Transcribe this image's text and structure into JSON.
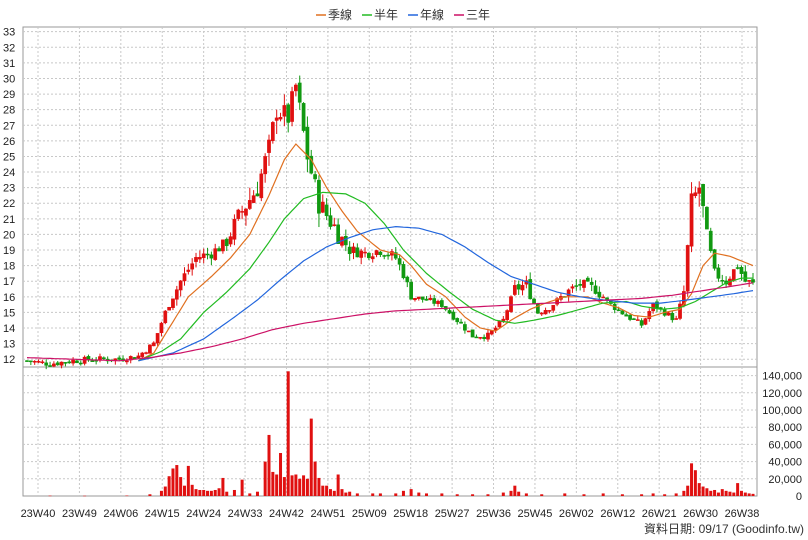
{
  "chart_data": {
    "type": "candlestick",
    "legend": [
      {
        "name": "季線",
        "color": "#e07020"
      },
      {
        "name": "半年",
        "color": "#22bb22"
      },
      {
        "name": "年線",
        "color": "#2266dd"
      },
      {
        "name": "三年",
        "color": "#cc1166"
      }
    ],
    "price_axis": {
      "min": 11.5,
      "max": 33.3,
      "ticks": [
        12,
        13,
        14,
        15,
        16,
        17,
        18,
        19,
        20,
        21,
        22,
        23,
        24,
        25,
        26,
        27,
        28,
        29,
        30,
        31,
        32,
        33
      ]
    },
    "volume_axis": {
      "min": 0,
      "max": 150000,
      "ticks": [
        0,
        20000,
        40000,
        60000,
        80000,
        100000,
        120000,
        140000
      ],
      "tick_labels": [
        "0",
        "20,000",
        "40,000",
        "60,000",
        "80,000",
        "100,000",
        "120,000",
        "140,000"
      ]
    },
    "x_labels": [
      "23W40",
      "23W49",
      "24W06",
      "24W15",
      "24W24",
      "24W33",
      "24W42",
      "24W51",
      "25W09",
      "25W18",
      "25W27",
      "25W36",
      "25W45",
      "26W02",
      "26W12",
      "26W21",
      "26W30",
      "26W38"
    ],
    "price_anchors": [
      [
        0,
        11.9
      ],
      [
        6,
        11.7
      ],
      [
        12,
        11.9
      ],
      [
        18,
        12.0
      ],
      [
        24,
        12.0
      ],
      [
        29,
        12.2
      ],
      [
        33,
        13.0
      ],
      [
        36,
        15.0
      ],
      [
        40,
        17.0
      ],
      [
        44,
        18.5
      ],
      [
        48,
        18.8
      ],
      [
        52,
        19.5
      ],
      [
        56,
        21.5
      ],
      [
        60,
        23.0
      ],
      [
        63,
        25.5
      ],
      [
        65,
        28.0
      ],
      [
        68,
        27.5
      ],
      [
        70,
        29.5
      ],
      [
        73,
        25.0
      ],
      [
        76,
        22.0
      ],
      [
        80,
        20.5
      ],
      [
        84,
        19.0
      ],
      [
        88,
        18.8
      ],
      [
        92,
        19.0
      ],
      [
        96,
        18.5
      ],
      [
        98,
        17.5
      ],
      [
        100,
        16.0
      ],
      [
        104,
        15.8
      ],
      [
        108,
        15.5
      ],
      [
        112,
        14.5
      ],
      [
        116,
        13.5
      ],
      [
        120,
        13.5
      ],
      [
        124,
        14.5
      ],
      [
        127,
        16.5
      ],
      [
        130,
        16.8
      ],
      [
        133,
        15.0
      ],
      [
        136,
        15.3
      ],
      [
        140,
        16.2
      ],
      [
        144,
        16.8
      ],
      [
        148,
        16.5
      ],
      [
        152,
        15.5
      ],
      [
        156,
        14.8
      ],
      [
        160,
        14.2
      ],
      [
        163,
        15.5
      ],
      [
        166,
        15.0
      ],
      [
        169,
        14.5
      ],
      [
        171,
        16.3
      ],
      [
        173,
        22.0
      ],
      [
        175,
        23.0
      ],
      [
        177,
        20.0
      ],
      [
        179,
        17.5
      ],
      [
        182,
        17.0
      ],
      [
        185,
        18.0
      ],
      [
        187,
        17.0
      ],
      [
        189,
        16.8
      ]
    ],
    "ma_anchors": {
      "season": [
        [
          29,
          11.9
        ],
        [
          33,
          12.4
        ],
        [
          37,
          14.0
        ],
        [
          42,
          16.0
        ],
        [
          48,
          17.3
        ],
        [
          53,
          18.5
        ],
        [
          58,
          20.0
        ],
        [
          63,
          22.5
        ],
        [
          67,
          24.8
        ],
        [
          70,
          25.8
        ],
        [
          74,
          24.8
        ],
        [
          78,
          23.0
        ],
        [
          82,
          21.5
        ],
        [
          86,
          20.2
        ],
        [
          92,
          19.0
        ],
        [
          97,
          18.7
        ],
        [
          100,
          18.0
        ],
        [
          104,
          16.8
        ],
        [
          109,
          16.0
        ],
        [
          114,
          14.7
        ],
        [
          118,
          14.0
        ],
        [
          122,
          13.8
        ],
        [
          126,
          14.5
        ],
        [
          131,
          15.2
        ],
        [
          135,
          15.6
        ],
        [
          140,
          16.0
        ],
        [
          146,
          16.0
        ],
        [
          150,
          15.6
        ],
        [
          154,
          15.3
        ],
        [
          158,
          14.8
        ],
        [
          162,
          14.7
        ],
        [
          166,
          15.0
        ],
        [
          170,
          15.2
        ],
        [
          173,
          16.2
        ],
        [
          176,
          18.0
        ],
        [
          179,
          18.8
        ],
        [
          183,
          18.6
        ],
        [
          186,
          18.3
        ],
        [
          189,
          18.0
        ]
      ],
      "half": [
        [
          29,
          11.9
        ],
        [
          35,
          12.5
        ],
        [
          40,
          13.3
        ],
        [
          46,
          15.0
        ],
        [
          52,
          16.3
        ],
        [
          58,
          17.8
        ],
        [
          63,
          19.5
        ],
        [
          67,
          21.0
        ],
        [
          72,
          22.3
        ],
        [
          77,
          22.7
        ],
        [
          83,
          22.6
        ],
        [
          88,
          22.0
        ],
        [
          93,
          20.7
        ],
        [
          98,
          19.0
        ],
        [
          104,
          17.5
        ],
        [
          110,
          16.3
        ],
        [
          116,
          15.2
        ],
        [
          122,
          14.5
        ],
        [
          127,
          14.3
        ],
        [
          132,
          14.5
        ],
        [
          138,
          14.8
        ],
        [
          144,
          15.2
        ],
        [
          150,
          15.6
        ],
        [
          156,
          15.7
        ],
        [
          160,
          15.4
        ],
        [
          165,
          15.2
        ],
        [
          170,
          15.3
        ],
        [
          174,
          15.7
        ],
        [
          178,
          16.3
        ],
        [
          182,
          16.9
        ],
        [
          186,
          17.2
        ],
        [
          189,
          17.2
        ]
      ],
      "year": [
        [
          29,
          11.9
        ],
        [
          38,
          12.4
        ],
        [
          46,
          13.3
        ],
        [
          54,
          14.7
        ],
        [
          60,
          15.8
        ],
        [
          66,
          17.1
        ],
        [
          72,
          18.3
        ],
        [
          78,
          19.2
        ],
        [
          84,
          19.8
        ],
        [
          90,
          20.3
        ],
        [
          96,
          20.5
        ],
        [
          102,
          20.4
        ],
        [
          108,
          20.0
        ],
        [
          114,
          19.2
        ],
        [
          120,
          18.2
        ],
        [
          126,
          17.3
        ],
        [
          132,
          16.8
        ],
        [
          138,
          16.3
        ],
        [
          144,
          16.0
        ],
        [
          150,
          15.8
        ],
        [
          158,
          15.6
        ],
        [
          165,
          15.6
        ],
        [
          172,
          15.8
        ],
        [
          178,
          16.0
        ],
        [
          184,
          16.2
        ],
        [
          189,
          16.4
        ]
      ],
      "three": [
        [
          0,
          12.1
        ],
        [
          12,
          12.0
        ],
        [
          24,
          11.9
        ],
        [
          32,
          12.1
        ],
        [
          40,
          12.4
        ],
        [
          48,
          12.8
        ],
        [
          56,
          13.3
        ],
        [
          64,
          13.9
        ],
        [
          72,
          14.3
        ],
        [
          80,
          14.6
        ],
        [
          88,
          14.9
        ],
        [
          96,
          15.1
        ],
        [
          104,
          15.2
        ],
        [
          112,
          15.3
        ],
        [
          120,
          15.4
        ],
        [
          128,
          15.5
        ],
        [
          136,
          15.6
        ],
        [
          144,
          15.7
        ],
        [
          152,
          15.8
        ],
        [
          160,
          15.9
        ],
        [
          168,
          16.1
        ],
        [
          176,
          16.4
        ],
        [
          184,
          16.7
        ],
        [
          189,
          16.9
        ]
      ]
    },
    "volume_spikes": [
      [
        6,
        400
      ],
      [
        15,
        300
      ],
      [
        26,
        500
      ],
      [
        32,
        2000
      ],
      [
        35,
        6000
      ],
      [
        36,
        11000
      ],
      [
        37,
        23000
      ],
      [
        38,
        32000
      ],
      [
        39,
        36000
      ],
      [
        40,
        22000
      ],
      [
        41,
        12000
      ],
      [
        42,
        35000
      ],
      [
        43,
        13000
      ],
      [
        44,
        8000
      ],
      [
        45,
        7000
      ],
      [
        46,
        7000
      ],
      [
        47,
        6000
      ],
      [
        48,
        6000
      ],
      [
        49,
        7000
      ],
      [
        50,
        9000
      ],
      [
        51,
        21000
      ],
      [
        52,
        5000
      ],
      [
        54,
        7000
      ],
      [
        56,
        19000
      ],
      [
        58,
        3000
      ],
      [
        60,
        5000
      ],
      [
        62,
        40000
      ],
      [
        63,
        71000
      ],
      [
        64,
        28000
      ],
      [
        65,
        25000
      ],
      [
        66,
        50000
      ],
      [
        67,
        22000
      ],
      [
        68,
        145000
      ],
      [
        69,
        24000
      ],
      [
        70,
        25000
      ],
      [
        71,
        20000
      ],
      [
        72,
        24000
      ],
      [
        73,
        20000
      ],
      [
        74,
        90000
      ],
      [
        75,
        40000
      ],
      [
        76,
        21000
      ],
      [
        77,
        12000
      ],
      [
        78,
        12000
      ],
      [
        79,
        8000
      ],
      [
        80,
        6000
      ],
      [
        81,
        25000
      ],
      [
        82,
        8000
      ],
      [
        83,
        4000
      ],
      [
        84,
        5000
      ],
      [
        86,
        3000
      ],
      [
        90,
        3000
      ],
      [
        92,
        3000
      ],
      [
        96,
        3000
      ],
      [
        98,
        6000
      ],
      [
        100,
        8000
      ],
      [
        102,
        4000
      ],
      [
        104,
        3000
      ],
      [
        108,
        3000
      ],
      [
        112,
        2000
      ],
      [
        116,
        2000
      ],
      [
        120,
        2000
      ],
      [
        124,
        4000
      ],
      [
        126,
        6000
      ],
      [
        127,
        12000
      ],
      [
        128,
        5000
      ],
      [
        130,
        3000
      ],
      [
        134,
        2000
      ],
      [
        140,
        3000
      ],
      [
        145,
        2000
      ],
      [
        150,
        3000
      ],
      [
        155,
        2000
      ],
      [
        160,
        2000
      ],
      [
        163,
        3000
      ],
      [
        166,
        2000
      ],
      [
        169,
        3000
      ],
      [
        171,
        6000
      ],
      [
        172,
        12000
      ],
      [
        173,
        38000
      ],
      [
        174,
        30000
      ],
      [
        175,
        15000
      ],
      [
        176,
        11000
      ],
      [
        177,
        9000
      ],
      [
        178,
        6000
      ],
      [
        179,
        7000
      ],
      [
        180,
        4000
      ],
      [
        181,
        8000
      ],
      [
        182,
        6000
      ],
      [
        183,
        5000
      ],
      [
        184,
        4000
      ],
      [
        185,
        15000
      ],
      [
        186,
        6000
      ],
      [
        187,
        4000
      ],
      [
        188,
        3000
      ],
      [
        189,
        2500
      ]
    ],
    "n_bars": 190,
    "grid": true
  },
  "source_label": "資料日期: 09/17 (Goodinfo.tw)"
}
